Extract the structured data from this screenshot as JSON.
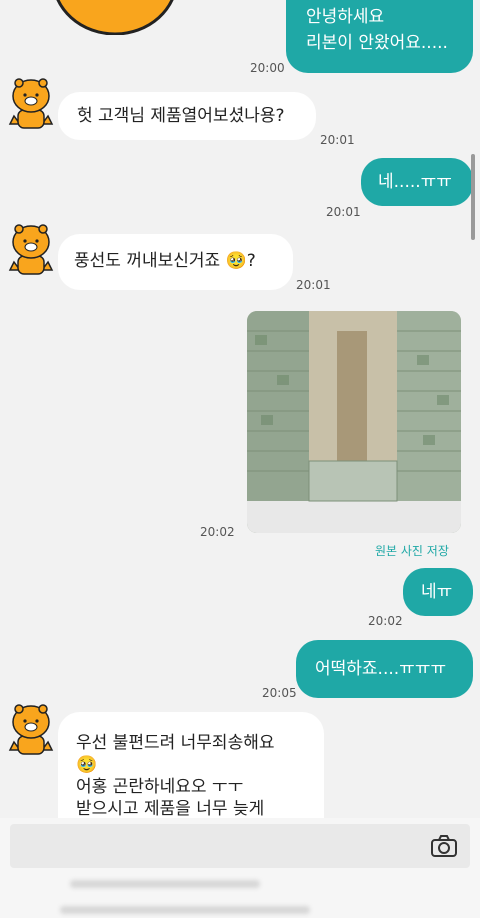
{
  "messages": [
    {
      "id": "m1",
      "dir": "out",
      "lines": [
        "안녕하세요",
        "리본이 안왔어요....."
      ],
      "time": "20:00"
    },
    {
      "id": "m2",
      "dir": "in",
      "text": "헛 고객님 제품열어보셨나용?",
      "time": "20:01"
    },
    {
      "id": "m3",
      "dir": "out",
      "text": "네.....ㅠㅠ",
      "time": "20:01"
    },
    {
      "id": "m4",
      "dir": "in",
      "text": "풍선도 꺼내보신거죠 🥹?",
      "time": "20:01"
    },
    {
      "id": "m5",
      "dir": "out-photo",
      "time": "20:02"
    },
    {
      "id": "m6",
      "dir": "out",
      "text": "네ㅠ",
      "time": "20:02"
    },
    {
      "id": "m7",
      "dir": "out",
      "text": "어떡하죠....ㅠㅠㅠ",
      "time": "20:05"
    },
    {
      "id": "m8",
      "dir": "in",
      "lines": [
        "우선 불편드려 너무죄송해요",
        "🥹",
        "어홍 곤란하네요오 ㅜㅜ",
        "받으시고 제품을 너무 늦게"
      ]
    }
  ],
  "photo": {
    "save_label": "원본 사진 저장"
  },
  "colors": {
    "outgoing": "#1fa8a6",
    "incoming": "#ffffff",
    "background": "#f2f2f2"
  },
  "icons": {
    "avatar": "lion-character-avatar-icon",
    "camera": "camera-icon"
  }
}
